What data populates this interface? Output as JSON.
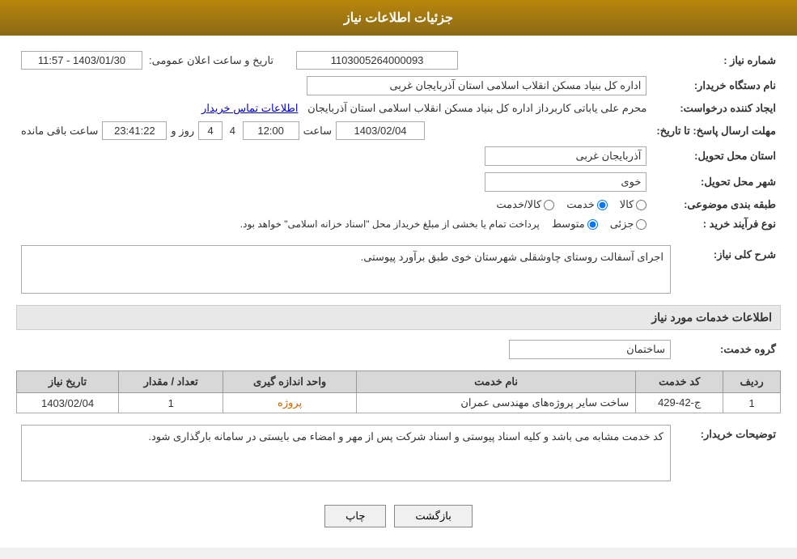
{
  "header": {
    "title": "جزئیات اطلاعات نیاز"
  },
  "fields": {
    "request_number_label": "شماره نیاز :",
    "request_number_value": "1103005264000093",
    "org_name_label": "نام دستگاه خریدار:",
    "org_name_value": "اداره کل بنیاد مسکن انقلاب اسلامی استان آذربایجان غربی",
    "creator_label": "ایجاد کننده درخواست:",
    "creator_value": "محرم علی یاباتی کاربرداز اداره کل بنیاد مسکن انقلاب اسلامی استان آذربایجان",
    "creator_link": "اطلاعات تماس خریدار",
    "deadline_label": "مهلت ارسال پاسخ: تا تاریخ:",
    "deadline_date": "1403/02/04",
    "deadline_time": "12:00",
    "deadline_day_label": "روز و",
    "deadline_days": "4",
    "deadline_remaining_label": "ساعت باقی مانده",
    "deadline_remaining_time": "23:41:22",
    "province_label": "استان محل تحویل:",
    "province_value": "آذربایجان غربی",
    "city_label": "شهر محل تحویل:",
    "city_value": "خوی",
    "category_label": "طبقه بندی موضوعی:",
    "category_options": [
      "کالا",
      "خدمت",
      "کالا/خدمت"
    ],
    "category_selected": "خدمت",
    "purchase_type_label": "نوع فرآیند خرید :",
    "purchase_options": [
      "جزئی",
      "متوسط"
    ],
    "purchase_note": "پرداخت تمام یا بخشی از مبلغ خریداز محل \"اسناد خزانه اسلامی\" خواهد بود.",
    "description_label": "شرح کلی نیاز:",
    "description_value": "اجرای آسفالت روستای چاوشقلی شهرستان خوی طبق برآورد پیوستی.",
    "services_header": "اطلاعات خدمات مورد نیاز",
    "service_group_label": "گروه خدمت:",
    "service_group_value": "ساختمان",
    "table_headers": {
      "row_num": "ردیف",
      "code": "کد خدمت",
      "name": "نام خدمت",
      "unit": "واحد اندازه گیری",
      "quantity": "تعداد / مقدار",
      "date": "تاریخ نیاز"
    },
    "table_rows": [
      {
        "row_num": "1",
        "code": "ج-42-429",
        "name": "ساخت سایر پروژه‌های مهندسی عمران",
        "unit": "پروژه",
        "quantity": "1",
        "date": "1403/02/04"
      }
    ],
    "buyer_notes_label": "توضیحات خریدار:",
    "buyer_notes_value": "کد خدمت مشابه می باشد و کلیه اسناد پیوستی و اسناد شرکت پس از مهر و امضاء می بایستی در سامانه بارگذاری شود.",
    "btn_print": "چاپ",
    "btn_back": "بازگشت"
  }
}
